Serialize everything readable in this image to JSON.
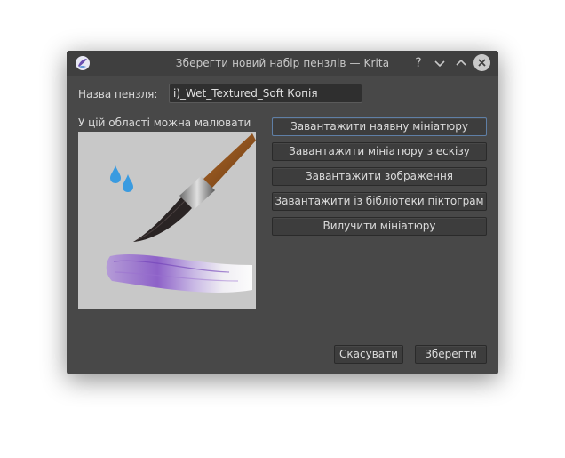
{
  "window": {
    "title": "Зберегти новий набір пензлів — Krita"
  },
  "titlebar": {
    "help_glyph": "?",
    "minimize_glyph": "⌄",
    "maximize_glyph": "⌃",
    "close_glyph": "✕"
  },
  "form": {
    "brush_name_label": "Назва пензля:",
    "brush_name_value": "i)_Wet_Textured_Soft Копія",
    "draw_area_label": "У цій області можна малювати"
  },
  "actions": {
    "load_existing": "Завантажити наявну мініатюру",
    "load_from_sketch": "Завантажити мініатюру з ескізу",
    "load_image": "Завантажити зображення",
    "load_from_icon_library": "Завантажити із бібліотеки піктограм",
    "clear_thumbnail": "Вилучити мініатюру"
  },
  "footer": {
    "cancel": "Скасувати",
    "save": "Зберегти"
  },
  "colors": {
    "window_bg": "#484848",
    "titlebar_bg": "#3f3f3f",
    "focus_border": "#5f7fa6",
    "canvas_bg": "#c8c8c8",
    "stroke_purple": "#8a5cc8",
    "water_drop": "#3a9be0"
  },
  "icons": {
    "app": "krita-icon",
    "help": "help-icon",
    "minimize": "chevron-down-icon",
    "maximize": "chevron-up-icon",
    "close": "close-icon"
  }
}
